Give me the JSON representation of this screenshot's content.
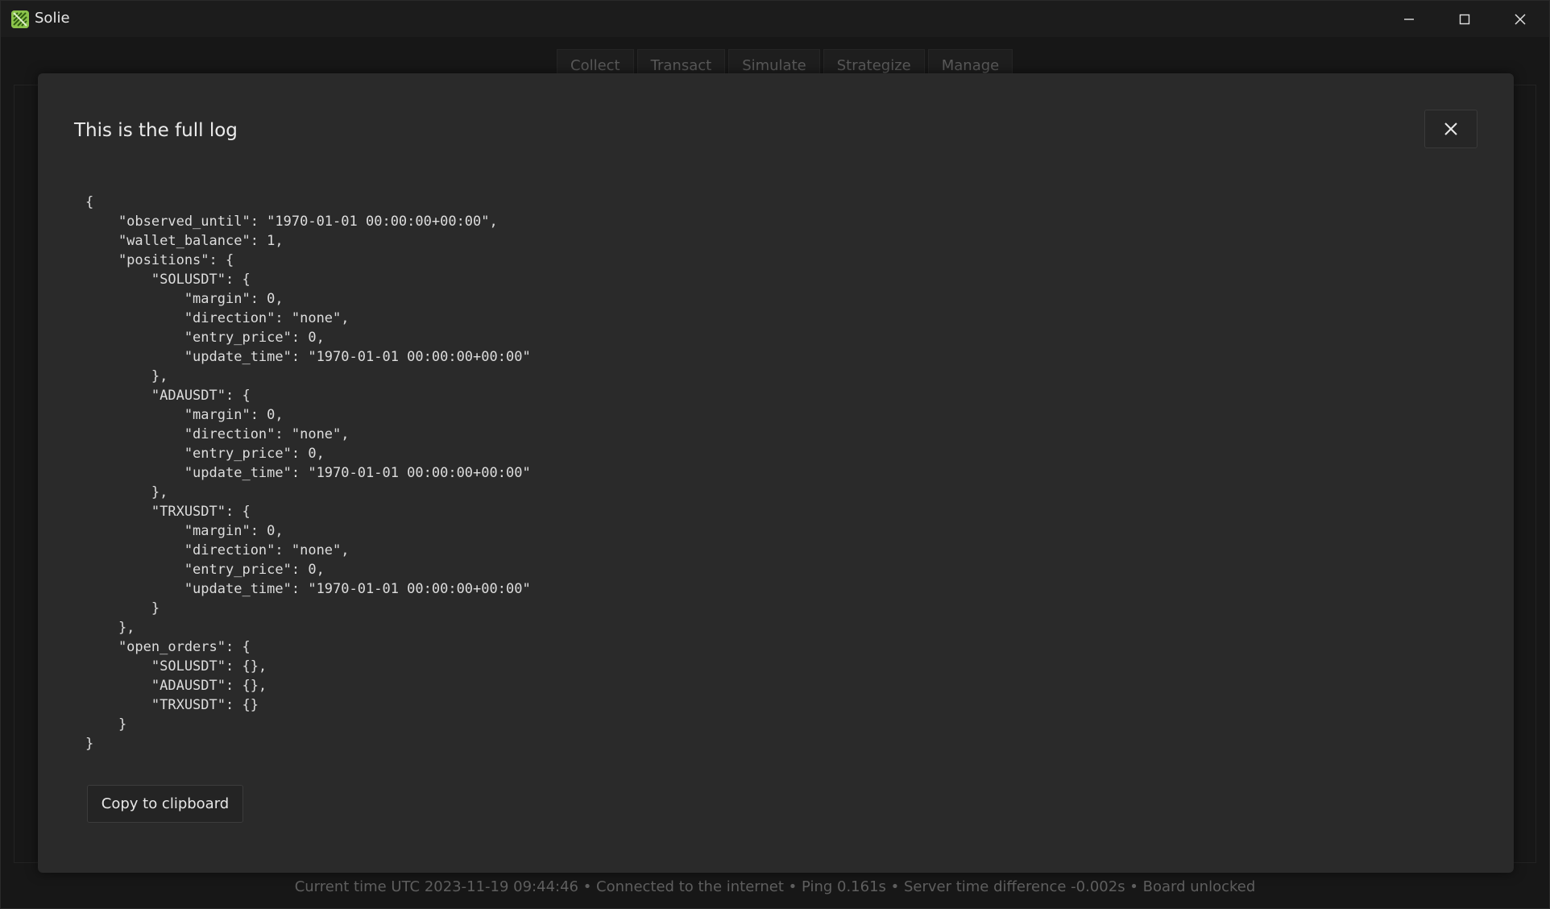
{
  "window": {
    "title": "Solie",
    "icons": {
      "app": "solie-app-icon",
      "minimize": "minimize-icon",
      "maximize": "maximize-icon",
      "close": "close-icon"
    }
  },
  "background": {
    "tabs": [
      "Collect",
      "Transact",
      "Simulate",
      "Strategize",
      "Manage"
    ],
    "status_text": "Current time UTC 2023-11-19 09:44:46  •  Connected to the internet  •  Ping 0.161s  •  Server time difference -0.002s  •  Board unlocked"
  },
  "dialog": {
    "title": "This is the full log",
    "close_icon": "close-icon",
    "log_text": "{\n    \"observed_until\": \"1970-01-01 00:00:00+00:00\",\n    \"wallet_balance\": 1,\n    \"positions\": {\n        \"SOLUSDT\": {\n            \"margin\": 0,\n            \"direction\": \"none\",\n            \"entry_price\": 0,\n            \"update_time\": \"1970-01-01 00:00:00+00:00\"\n        },\n        \"ADAUSDT\": {\n            \"margin\": 0,\n            \"direction\": \"none\",\n            \"entry_price\": 0,\n            \"update_time\": \"1970-01-01 00:00:00+00:00\"\n        },\n        \"TRXUSDT\": {\n            \"margin\": 0,\n            \"direction\": \"none\",\n            \"entry_price\": 0,\n            \"update_time\": \"1970-01-01 00:00:00+00:00\"\n        }\n    },\n    \"open_orders\": {\n        \"SOLUSDT\": {},\n        \"ADAUSDT\": {},\n        \"TRXUSDT\": {}\n    }\n}",
    "copy_button_label": "Copy to clipboard"
  },
  "colors": {
    "window_bg": "#171717",
    "dialog_bg": "#2a2a2a",
    "app_icon": "#8bc34a",
    "text": "#dddddd"
  }
}
